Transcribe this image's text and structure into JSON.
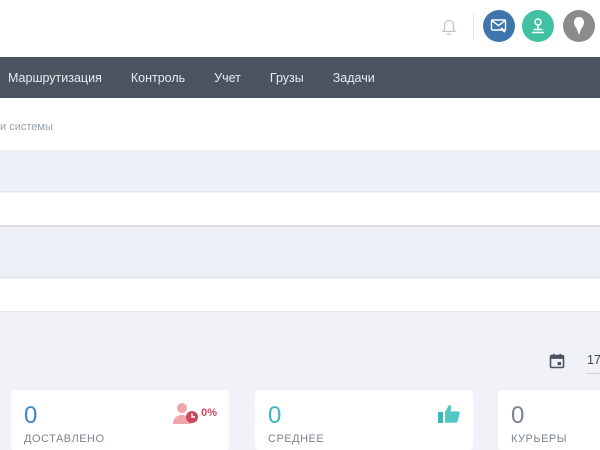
{
  "header": {
    "icons": {
      "notifications": "bell-icon",
      "messages": "mail-icon",
      "account": "user-icon",
      "avatar": "avatar-icon"
    },
    "colors": {
      "messages_bg": "#3f74ad",
      "account_bg": "#41c1a1",
      "avatar_bg": "#8b8b8b"
    }
  },
  "nav": {
    "items": [
      {
        "label": "Маршрутизация"
      },
      {
        "label": "Контроль"
      },
      {
        "label": "Учет"
      },
      {
        "label": "Грузы"
      },
      {
        "label": "Задачи"
      }
    ],
    "bg": "#4a5360"
  },
  "breadcrumb": {
    "text": "и системы"
  },
  "date": {
    "value": "17"
  },
  "stats": [
    {
      "value": "0",
      "label": "ДОСТАВЛЕНО",
      "badge": "0%",
      "color": "#3b86c8"
    },
    {
      "value": "0",
      "label": "СРЕДНЕЕ",
      "color": "#3cb8ba"
    },
    {
      "value": "0",
      "label": "КУРЬЕРЫ",
      "color": "#7b8190"
    }
  ]
}
